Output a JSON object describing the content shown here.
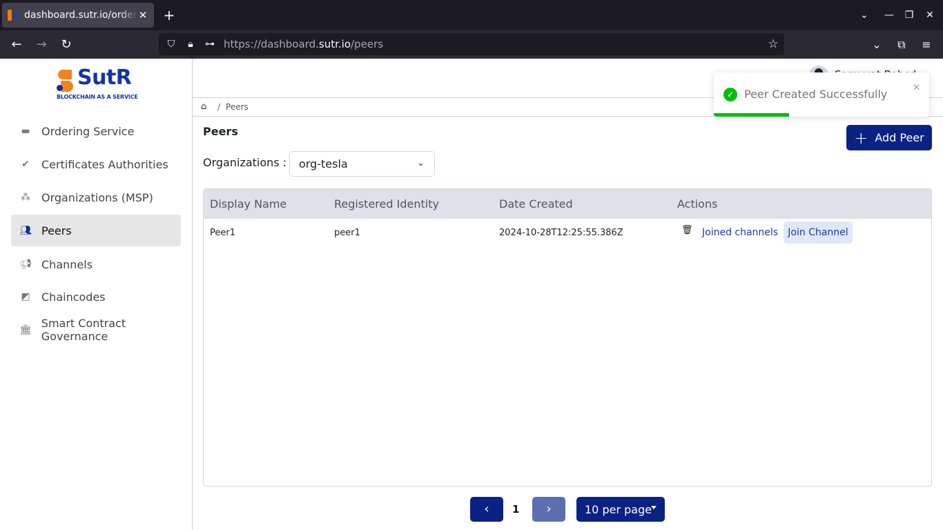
{
  "browser": {
    "tab_title": "dashboard.sutr.io/ordering-service",
    "url_prefix": "https://dashboard.",
    "url_domain": "sutr.io",
    "url_path": "/peers",
    "icons": {
      "back": "←",
      "forward": "→",
      "reload": "↻",
      "shield": "⛉",
      "lock": "🔒︎",
      "key": "⊶",
      "star": "☆",
      "pocket": "⌄",
      "extensions": "⧉",
      "menu": "≡",
      "tab_list": "⌄",
      "minimize": "—",
      "restore": "❐",
      "close": "✕",
      "new_tab": "+",
      "tab_close": "✕"
    }
  },
  "logo": {
    "name": "SutR",
    "tagline": "BLOCKCHAIN AS A SERVICE"
  },
  "sidebar": {
    "items": [
      {
        "label": "Ordering Service",
        "icon": "archive-box",
        "glyph": "▬",
        "active": false
      },
      {
        "label": "Certificates Authorities",
        "icon": "verified-badge",
        "glyph": "✔",
        "active": false
      },
      {
        "label": "Organizations (MSP)",
        "icon": "hierarchy",
        "glyph": "⁂",
        "active": false
      },
      {
        "label": "Peers",
        "icon": "users",
        "glyph": "👥︎",
        "active": true
      },
      {
        "label": "Channels",
        "icon": "megaphone",
        "glyph": "📢︎",
        "active": false
      },
      {
        "label": "Chaincodes",
        "icon": "tag-square",
        "glyph": "◩",
        "active": false
      },
      {
        "label": "Smart Contract Governance",
        "icon": "bank",
        "glyph": "🏛︎",
        "active": false
      }
    ]
  },
  "header": {
    "username": "Samyuat Babcd"
  },
  "breadcrumb": {
    "home_icon": "⌂",
    "separator": "/",
    "current": "Peers"
  },
  "page": {
    "title": "Peers",
    "add_button": "Add Peer",
    "add_icon": "+",
    "org_label": "Organizations :",
    "org_selected": "org-tesla",
    "org_chevron": "⌄"
  },
  "table": {
    "columns": [
      "Display Name",
      "Registered Identity",
      "Date Created",
      "Actions"
    ],
    "rows": [
      {
        "display_name": "Peer1",
        "registered_identity": "peer1",
        "date_created": "2024-10-28T12:25:55.386Z",
        "actions": {
          "delete_icon": "🗑︎",
          "joined_channels": "Joined channels",
          "join_channel": "Join Channel"
        }
      }
    ]
  },
  "pagination": {
    "prev": "‹",
    "current_page": "1",
    "next": "›",
    "per_page": "10 per page"
  },
  "toast": {
    "message": "Peer Created Successfully",
    "type": "success",
    "check": "✓",
    "close": "×",
    "progress_percent": 35,
    "color": "#07bc0c"
  },
  "colors": {
    "primary": "#0a2284",
    "accent_orange": "#f58220",
    "link": "#1a3aa8"
  }
}
